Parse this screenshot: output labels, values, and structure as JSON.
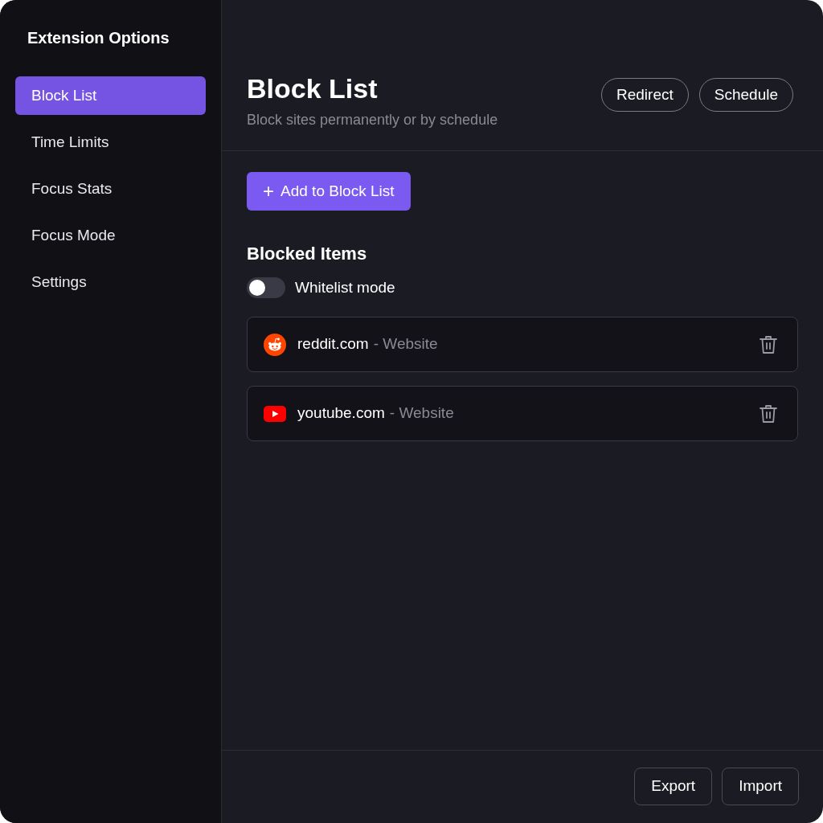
{
  "sidebar": {
    "title": "Extension Options",
    "items": [
      {
        "label": "Block List",
        "selected": true
      },
      {
        "label": "Time Limits",
        "selected": false
      },
      {
        "label": "Focus Stats",
        "selected": false
      },
      {
        "label": "Focus Mode",
        "selected": false
      },
      {
        "label": "Settings",
        "selected": false
      }
    ]
  },
  "header": {
    "title": "Block List",
    "subtitle": "Block sites permanently or by schedule",
    "buttons": [
      "Redirect",
      "Schedule"
    ]
  },
  "add_button": {
    "icon": "+",
    "label": "Add to Block List"
  },
  "blocked_items": {
    "title": "Blocked Items",
    "toggle": {
      "label": "Whitelist mode",
      "on": false
    },
    "items": [
      {
        "kind": "alien",
        "site": "reddit.com",
        "detail": "- Website"
      },
      {
        "kind": "play",
        "site": "youtube.com",
        "detail": "- Website"
      }
    ]
  },
  "footer": {
    "buttons": [
      "Export",
      "Import"
    ]
  }
}
